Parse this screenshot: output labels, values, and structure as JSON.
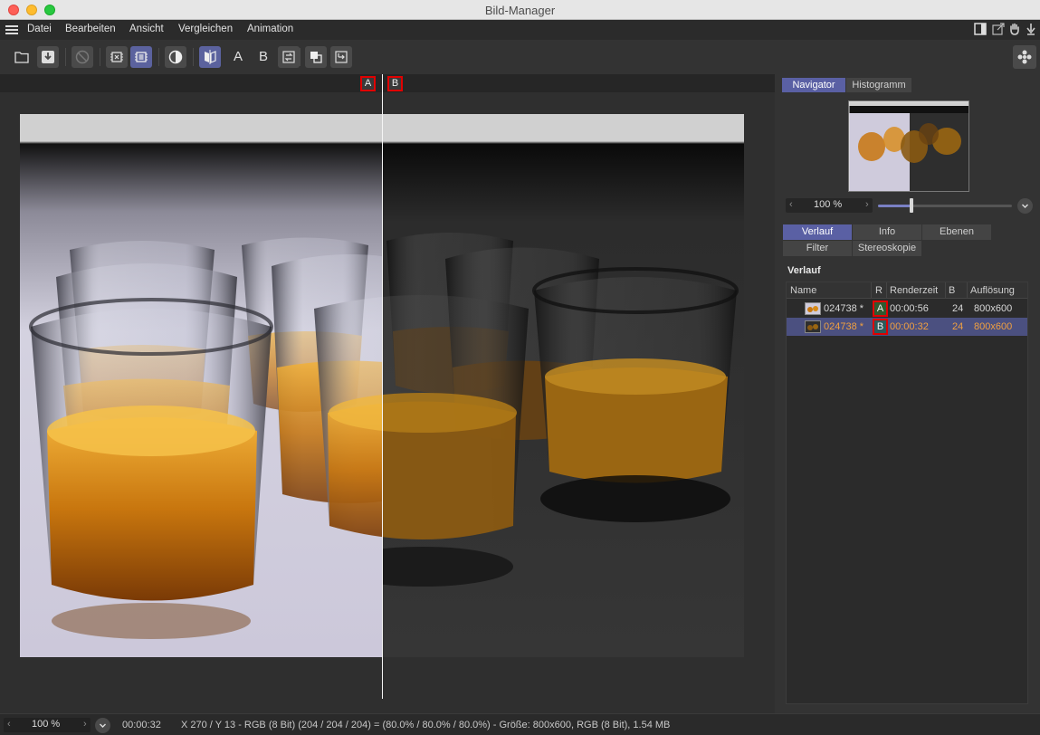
{
  "window": {
    "title": "Bild-Manager"
  },
  "menubar": {
    "items": [
      "Datei",
      "Bearbeiten",
      "Ansicht",
      "Vergleichen",
      "Animation"
    ],
    "right_icons": [
      "panel-layout-icon",
      "external-window-icon",
      "hand-icon",
      "pin-icon"
    ]
  },
  "toolbar": {
    "buttons": [
      {
        "name": "open-folder-icon"
      },
      {
        "name": "save-icon"
      },
      {
        "name": "stop-icon"
      },
      {
        "name": "region-render-icon"
      },
      {
        "name": "region-render-active-icon"
      },
      {
        "name": "contrast-icon"
      },
      {
        "name": "compare-ab-icon"
      },
      {
        "label": "A"
      },
      {
        "label": "B"
      },
      {
        "name": "swap-icon"
      },
      {
        "name": "overlay-icon"
      },
      {
        "name": "export-icon"
      }
    ],
    "right_icon": "plugin-icon"
  },
  "viewer": {
    "marker_a": "A",
    "marker_b": "B"
  },
  "navigator": {
    "tabs": [
      "Navigator",
      "Histogramm"
    ],
    "active_tab": "Navigator",
    "zoom": "100 %",
    "slider_fraction": 0.25
  },
  "panel_tabs": {
    "row1": [
      "Verlauf",
      "Info",
      "Ebenen"
    ],
    "row2": [
      "Filter",
      "Stereoskopie"
    ],
    "active": "Verlauf"
  },
  "history": {
    "title": "Verlauf",
    "columns": [
      "Name",
      "R",
      "Renderzeit",
      "B",
      "Auflösung"
    ],
    "rows": [
      {
        "name": "024738 *",
        "r": "A",
        "render_time": "00:00:56",
        "b": "24",
        "resolution": "800x600",
        "selected": false
      },
      {
        "name": "024738 *",
        "r": "B",
        "render_time": "00:00:32",
        "b": "24",
        "resolution": "800x600",
        "selected": true
      }
    ]
  },
  "statusbar": {
    "zoom": "100 %",
    "time": "00:00:32",
    "info": "X 270 / Y 13 - RGB (8 Bit) (204 / 204 / 204) = (80.0% / 80.0% / 80.0%) - Größe: 800x600, RGB (8 Bit), 1.54 MB"
  },
  "colors": {
    "accent": "#5a60a4",
    "marker_border": "#e00000",
    "selected_row_text": "#f0a040"
  }
}
